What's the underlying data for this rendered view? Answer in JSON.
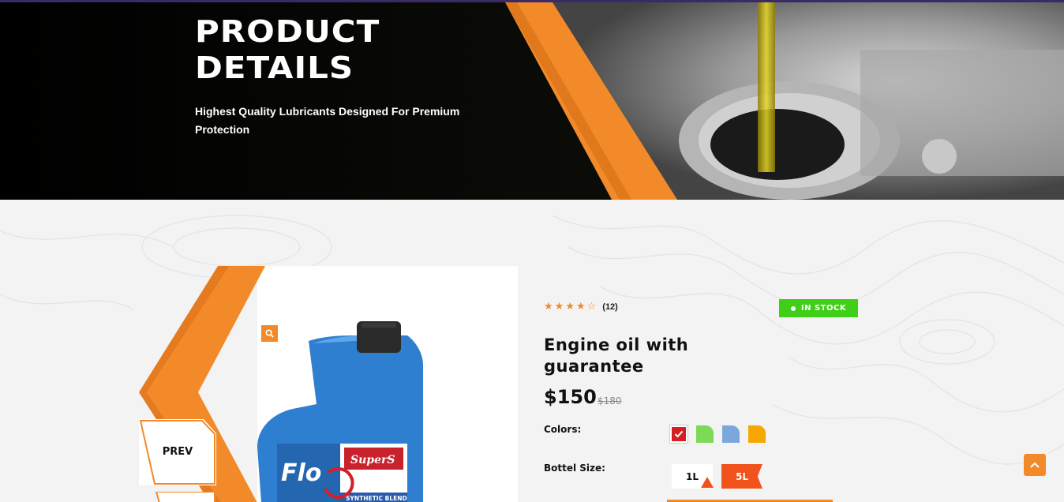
{
  "hero": {
    "title_line1": "PRODUCT",
    "title_line2": "DETAILS",
    "subtitle": "Highest Quality Lubricants Designed For Premium Protection"
  },
  "gallery": {
    "zoom_icon": "search-icon",
    "prev_label": "PREV",
    "bottle_brand": "Flo",
    "bottle_badge": "SuperS",
    "bottle_band": "SYNTHETIC BLEND"
  },
  "product": {
    "rating_stars": 4,
    "rating_max": 5,
    "review_count": "(12)",
    "stock_label": "IN STOCK",
    "title": "Engine oil with guarantee",
    "price": "$150",
    "old_price": "$180",
    "colors_label": "Colors:",
    "colors": [
      "#d32027",
      "#7ed957",
      "#7ba7dd",
      "#f7a800"
    ],
    "selected_color": "#d32027",
    "size_label": "Bottel Size:",
    "sizes": [
      "1L",
      "5L"
    ],
    "selected_size": "5L"
  },
  "theme": {
    "accent": "#f28a2a",
    "stock_green": "#3fcf18",
    "size_active": "#f2521b"
  },
  "scroll_top_icon": "chevron-up-icon"
}
